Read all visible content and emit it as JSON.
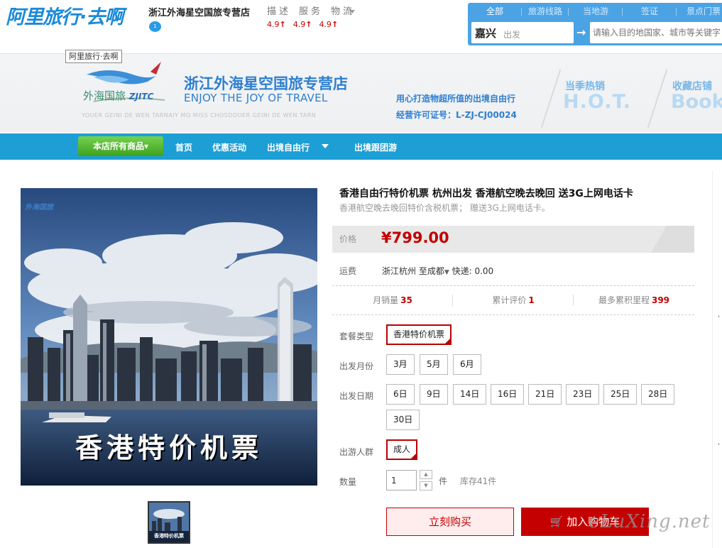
{
  "header": {
    "logo": "阿里旅行·去啊",
    "shop_name": "浙江外海星空国旅专营店",
    "shop_badge": "1",
    "ratings": {
      "labels": [
        "描述",
        "服务",
        "物流"
      ],
      "items": [
        {
          "value": "4.9",
          "trend": "↑"
        },
        {
          "value": "4.9",
          "trend": "↑"
        },
        {
          "value": "4.9",
          "trend": "↑"
        }
      ]
    },
    "search": {
      "tabs": [
        "全部",
        "旅游线路",
        "当地游",
        "签证",
        "景点门票"
      ],
      "from_city": "嘉兴",
      "from_label": "出发",
      "arrow": "→",
      "to_placeholder": "请输入目的地国家、城市等关键字"
    }
  },
  "banner": {
    "tag": "阿里旅行·去啊",
    "logo_cn": "外海国旅",
    "logo_en": "ZJITC",
    "scroll_text": "YOUER GEINI DE WEN TARNAIY MO MISS CHOSDOUER GEINI DE WEN TARN",
    "title": "浙江外海星空国旅专营店",
    "subtitle": "ENJOY THE JOY OF TRAVEL",
    "slogan": "用心打造物超所值的出境自由行",
    "license": "经营许可证号：L-ZJ-CJ00024",
    "hot_title": "当季热销",
    "hot_text": "H.O.T.",
    "fav_title": "收藏店铺",
    "fav_text": "Book"
  },
  "nav": {
    "all_products": "本店所有商品",
    "items": [
      "首页",
      "优惠活动",
      "出境自由行",
      "出境跟团游"
    ]
  },
  "product": {
    "image_caption": "香港特价机票",
    "image_logo": "外海国旅",
    "title": "香港自由行特价机票 杭州出发 香港航空晚去晚回 送3G上网电话卡",
    "subtitle": "香港航空晚去晚回特价含税机票；  赠送3G上网电话卡。",
    "price_label": "价格",
    "price": "¥799.00",
    "shipping_label": "运费",
    "shipping_from": "浙江杭州",
    "shipping_to": "至成都",
    "shipping_caret": "▼",
    "shipping_fee": "快递: 0.00",
    "stats": [
      {
        "label": "月销量",
        "value": "35"
      },
      {
        "label": "累计评价",
        "value": "1"
      },
      {
        "label": "最多累积里程",
        "value": "399"
      }
    ],
    "package_label": "套餐类型",
    "package_options": [
      "香港特价机票"
    ],
    "month_label": "出发月份",
    "month_options": [
      "3月",
      "5月",
      "6月"
    ],
    "date_label": "出发日期",
    "date_options": [
      "6日",
      "9日",
      "14日",
      "16日",
      "21日",
      "23日",
      "25日",
      "28日",
      "30日"
    ],
    "people_label": "出游人群",
    "people_options": [
      "成人"
    ],
    "qty_label": "数量",
    "qty_value": "1",
    "qty_up": "▲",
    "qty_down": "▼",
    "qty_unit": "件",
    "stock": "库存41件",
    "buy_now": "立刻购买",
    "add_cart": "加入购物车",
    "cart_icon": "🛒"
  },
  "watermark": "eLuXing.net",
  "colors": {
    "brand_blue": "#1d9fd6",
    "price_red": "#c40000",
    "nav_green": "#3ea11e"
  }
}
